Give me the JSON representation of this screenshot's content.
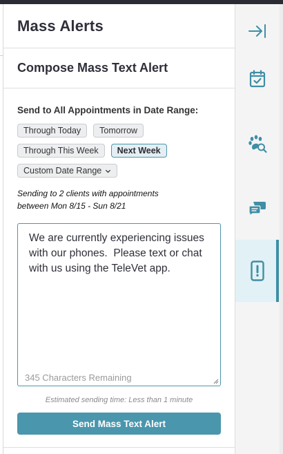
{
  "panel": {
    "title": "Mass Alerts"
  },
  "compose": {
    "title": "Compose Mass Text Alert",
    "range_label": "Send to All Appointments in Date Range:",
    "chips": [
      {
        "label": "Through Today",
        "selected": false
      },
      {
        "label": "Tomorrow",
        "selected": false
      },
      {
        "label": "Through This Week",
        "selected": false
      },
      {
        "label": "Next Week",
        "selected": true
      },
      {
        "label": "Custom Date Range",
        "selected": false
      }
    ],
    "sending_note_line1": "Sending to 2 clients with appointments",
    "sending_note_line2": "between Mon 8/15 - Sun 8/21",
    "message": "We are currently experiencing issues with our phones.  Please text or chat with us using the TeleVet app.",
    "chars_remaining": "345 Characters Remaining",
    "estimate": "Estimated sending time: Less than 1 minute",
    "send_label": "Send Mass Text Alert"
  },
  "rail": {
    "items": [
      {
        "icon": "collapse-panel-icon",
        "active": false
      },
      {
        "icon": "calendar-check-icon",
        "active": false
      },
      {
        "icon": "paw-search-icon",
        "active": false
      },
      {
        "icon": "chat-bubbles-icon",
        "active": false
      },
      {
        "icon": "mobile-alert-icon",
        "active": true
      }
    ]
  },
  "colors": {
    "accent": "#4a96ad",
    "active_rail_bg": "#e2f1f5",
    "icon": "#3f8ea5"
  }
}
